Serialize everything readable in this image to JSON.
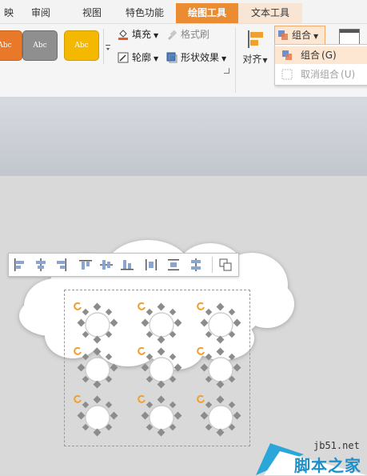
{
  "tabs": [
    {
      "label": "映"
    },
    {
      "label": "审阅"
    },
    {
      "label": "视图"
    },
    {
      "label": "特色功能"
    },
    {
      "label": "绘图工具"
    },
    {
      "label": "文本工具"
    }
  ],
  "style_swatches": [
    {
      "label": "Abc",
      "color": "#e8782a"
    },
    {
      "label": "Abc",
      "color": "#8f8f8f"
    },
    {
      "label": "Abc",
      "color": "#f5b800"
    }
  ],
  "ribbon": {
    "fill": "填充",
    "format_painter": "格式刷",
    "outline": "轮廓",
    "shape_effects": "形状效果",
    "align": "对齐",
    "group": "组合"
  },
  "group_menu": {
    "items": [
      {
        "label": "组合",
        "shortcut": "(G)"
      },
      {
        "label": "取消组合",
        "shortcut": "(U)"
      }
    ]
  },
  "watermark": {
    "site": "jb51.net",
    "name": "脚本之家"
  },
  "colors": {
    "accent": "#eb8b32",
    "rotate_handle": "#f0a030",
    "handle": "#8c8c8c"
  }
}
